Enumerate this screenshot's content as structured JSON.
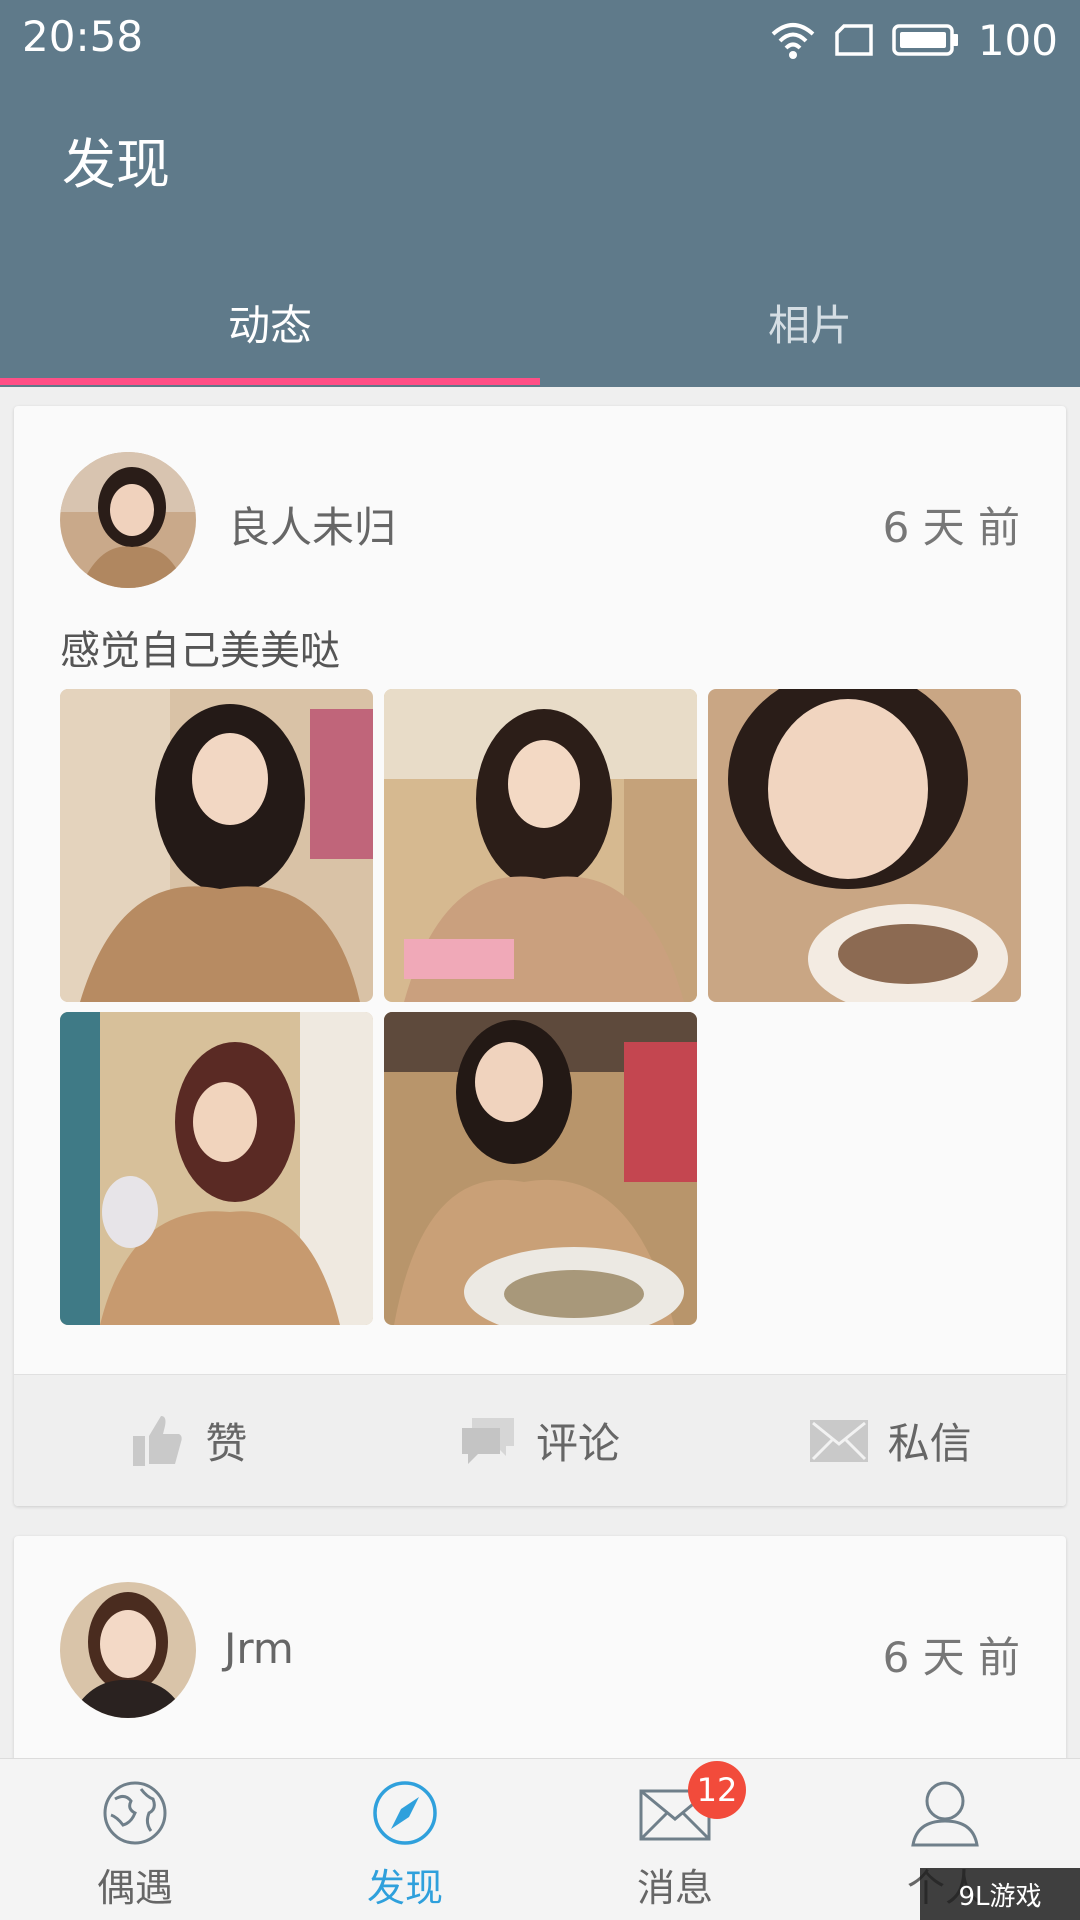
{
  "status_bar": {
    "time": "20:58",
    "battery": "100"
  },
  "header": {
    "title": "发现"
  },
  "tabs": [
    {
      "label": "动态",
      "active": true
    },
    {
      "label": "相片",
      "active": false
    }
  ],
  "feed": [
    {
      "username": "良人未归",
      "time": "6 天 前",
      "text": "感觉自己美美哒",
      "photo_count": 5,
      "actions": [
        {
          "label": "赞",
          "icon": "thumbs-up-icon"
        },
        {
          "label": "评论",
          "icon": "comment-icon"
        },
        {
          "label": "私信",
          "icon": "mail-icon"
        }
      ]
    },
    {
      "username": "Jrm",
      "time": "6 天 前"
    }
  ],
  "bottom_nav": [
    {
      "label": "偶遇",
      "icon": "globe-icon",
      "active": false
    },
    {
      "label": "发现",
      "icon": "compass-icon",
      "active": true
    },
    {
      "label": "消息",
      "icon": "mail-icon",
      "active": false,
      "badge": "12"
    },
    {
      "label": "个人",
      "icon": "person-icon",
      "active": false
    }
  ],
  "watermark": "9L游戏",
  "colors": {
    "header_bg": "#5f7a8a",
    "tab_indicator": "#ff4f86",
    "active_nav": "#2fa0dc",
    "badge": "#f24b3b"
  }
}
